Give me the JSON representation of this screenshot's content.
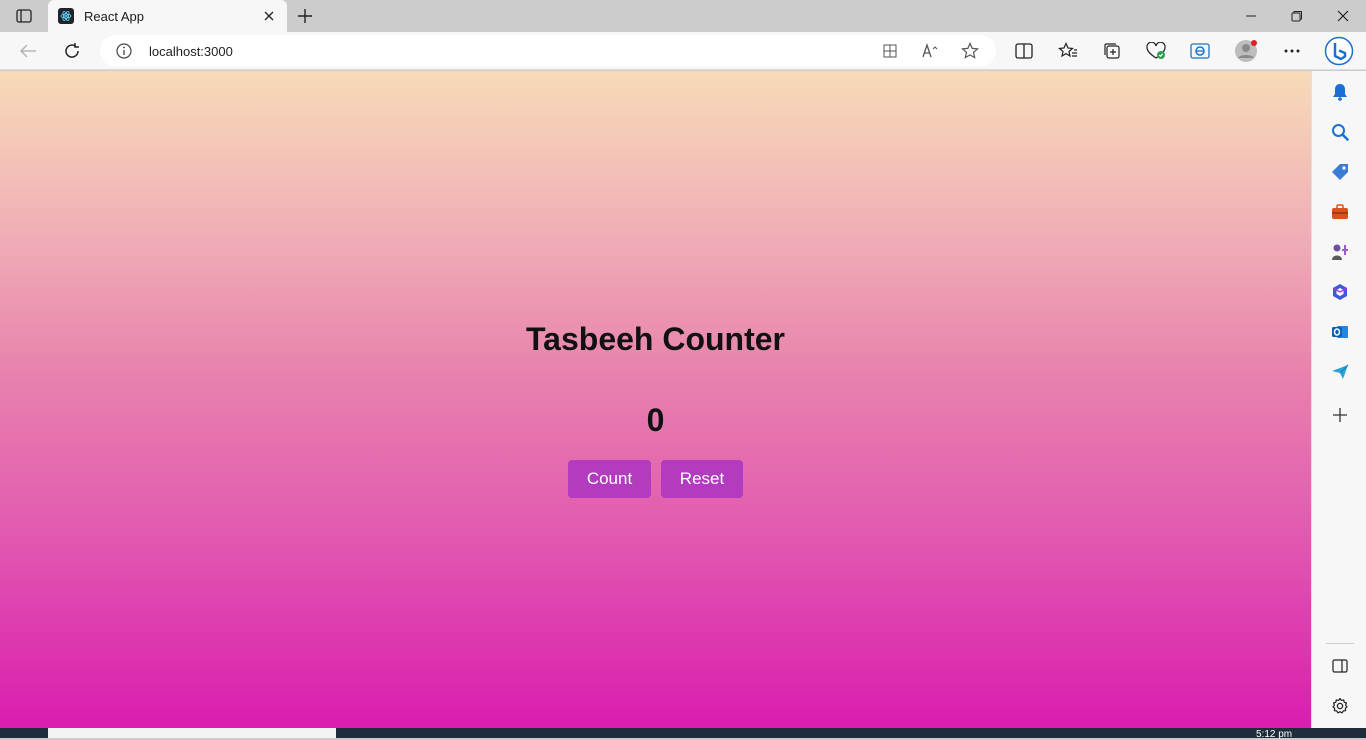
{
  "browser": {
    "tab_title": "React App",
    "address": "localhost:3000",
    "taskbar_time": "5:12 pm"
  },
  "app": {
    "title": "Tasbeeh Counter",
    "count": "0",
    "count_button": "Count",
    "reset_button": "Reset"
  },
  "colors": {
    "button": "#b23bbf",
    "gradient_top": "#f7dbb8",
    "gradient_bottom": "#da1daf"
  }
}
